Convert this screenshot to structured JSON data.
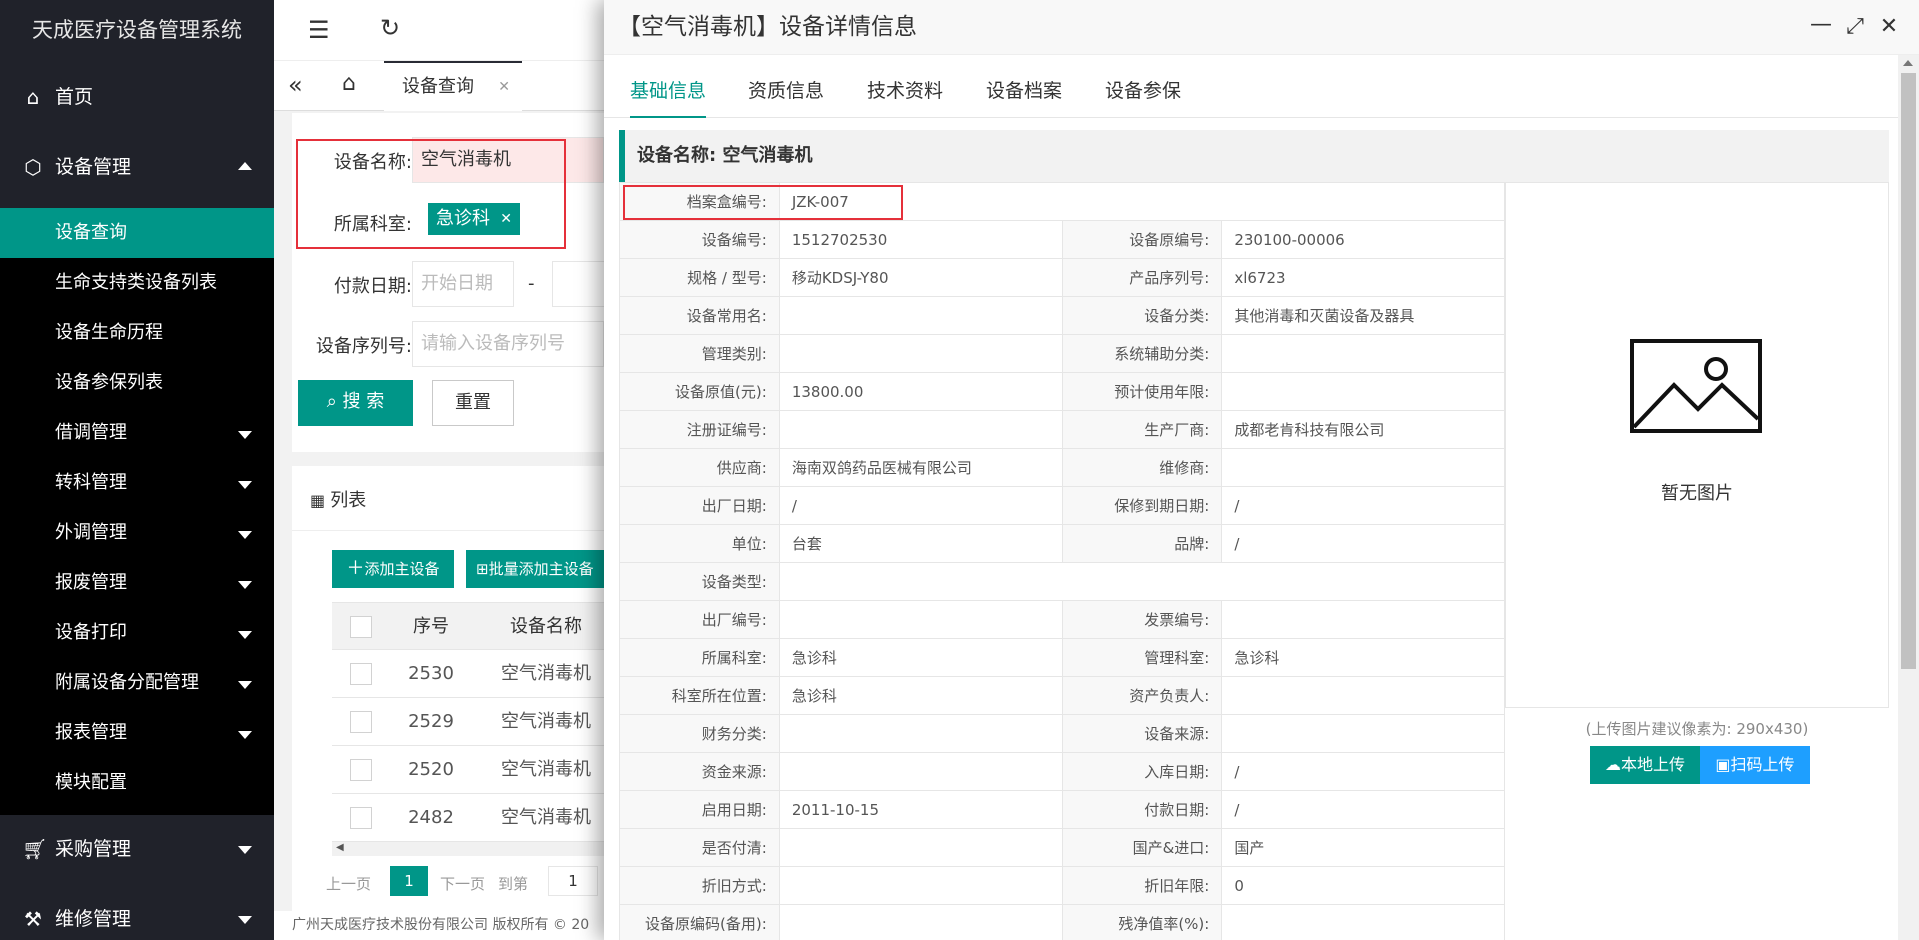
{
  "app": {
    "title": "天成医疗设备管理系统"
  },
  "sidebar": {
    "home": "首页",
    "device_mgmt": "设备管理",
    "sub_items": [
      {
        "label": "设备查询"
      },
      {
        "label": "生命支持类设备列表"
      },
      {
        "label": "设备生命历程"
      },
      {
        "label": "设备参保列表"
      },
      {
        "label": "借调管理"
      },
      {
        "label": "转科管理"
      },
      {
        "label": "外调管理"
      },
      {
        "label": "报废管理"
      },
      {
        "label": "设备打印"
      },
      {
        "label": "附属设备分配管理"
      },
      {
        "label": "报表管理"
      },
      {
        "label": "模块配置"
      }
    ],
    "purchase": "采购管理",
    "repair": "维修管理"
  },
  "tabs": {
    "active": "设备查询"
  },
  "search": {
    "name_label": "设备名称:",
    "name_value": "空气消毒机",
    "dept_label": "所属科室:",
    "dept_tag": "急诊科",
    "pay_label": "付款日期:",
    "pay_start_placeholder": "开始日期",
    "pay_sep": "-",
    "serial_label": "设备序列号:",
    "serial_placeholder": "请输入设备序列号",
    "search_btn": "搜 索",
    "reset_btn": "重置"
  },
  "list": {
    "title": "列表",
    "add_btn": "添加主设备",
    "batch_btn": "批量添加主设备",
    "headers": [
      "序号",
      "设备名称"
    ],
    "rows": [
      {
        "no": "2530",
        "name": "空气消毒机"
      },
      {
        "no": "2529",
        "name": "空气消毒机"
      },
      {
        "no": "2520",
        "name": "空气消毒机"
      },
      {
        "no": "2482",
        "name": "空气消毒机"
      }
    ],
    "pager": {
      "prev": "上一页",
      "page": "1",
      "next": "下一页",
      "goto": "到第",
      "goto_value": "1"
    }
  },
  "footer": "广州天成医疗技术股份有限公司 版权所有 © 20",
  "modal": {
    "title": "【空气消毒机】设备详情信息",
    "tabs": [
      "基础信息",
      "资质信息",
      "技术资料",
      "设备档案",
      "设备参保"
    ],
    "section": "设备名称: 空气消毒机",
    "rows": [
      {
        "k1": "档案盒编号:",
        "v1": "JZK-007",
        "k2": "",
        "v2": ""
      },
      {
        "k1": "设备编号:",
        "v1": "1512702530",
        "k2": "设备原编号:",
        "v2": "230100-00006"
      },
      {
        "k1": "规格 / 型号:",
        "v1": "移动KDSJ-Y80",
        "k2": "产品序列号:",
        "v2": "xl6723"
      },
      {
        "k1": "设备常用名:",
        "v1": "",
        "k2": "设备分类:",
        "v2": "其他消毒和灭菌设备及器具"
      },
      {
        "k1": "管理类别:",
        "v1": "",
        "k2": "系统辅助分类:",
        "v2": ""
      },
      {
        "k1": "设备原值(元):",
        "v1": "13800.00",
        "k2": "预计使用年限:",
        "v2": ""
      },
      {
        "k1": "注册证编号:",
        "v1": "",
        "k2": "生产厂商:",
        "v2": "成都老肯科技有限公司"
      },
      {
        "k1": "供应商:",
        "v1": "海南双鸽药品医械有限公司",
        "k2": "维修商:",
        "v2": ""
      },
      {
        "k1": "出厂日期:",
        "v1": "/",
        "k2": "保修到期日期:",
        "v2": "/"
      },
      {
        "k1": "单位:",
        "v1": "台套",
        "k2": "品牌:",
        "v2": "/"
      },
      {
        "k1": "设备类型:",
        "v1": "",
        "k2": "",
        "v2": ""
      },
      {
        "k1": "出厂编号:",
        "v1": "",
        "k2": "发票编号:",
        "v2": ""
      },
      {
        "k1": "所属科室:",
        "v1": "急诊科",
        "k2": "管理科室:",
        "v2": "急诊科"
      },
      {
        "k1": "科室所在位置:",
        "v1": "急诊科",
        "k2": "资产负责人:",
        "v2": ""
      },
      {
        "k1": "财务分类:",
        "v1": "",
        "k2": "设备来源:",
        "v2": ""
      },
      {
        "k1": "资金来源:",
        "v1": "",
        "k2": "入库日期:",
        "v2": "/"
      },
      {
        "k1": "启用日期:",
        "v1": "2011-10-15",
        "k2": "付款日期:",
        "v2": "/"
      },
      {
        "k1": "是否付清:",
        "v1": "",
        "k2": "国产&进口:",
        "v2": "国产"
      },
      {
        "k1": "折旧方式:",
        "v1": "",
        "k2": "折旧年限:",
        "v2": "0"
      },
      {
        "k1": "设备原编码(备用):",
        "v1": "",
        "k2": "残净值率(%):",
        "v2": ""
      }
    ],
    "no_image": "暂无图片",
    "upload_hint": "(上传图片建议像素为: 290x430)",
    "local_upload": "本地上传",
    "scan_upload": "扫码上传"
  },
  "colors": {
    "primary": "#009688",
    "sidebar": "#20222a",
    "blue": "#1e9fff",
    "highlight": "#e5303a"
  }
}
